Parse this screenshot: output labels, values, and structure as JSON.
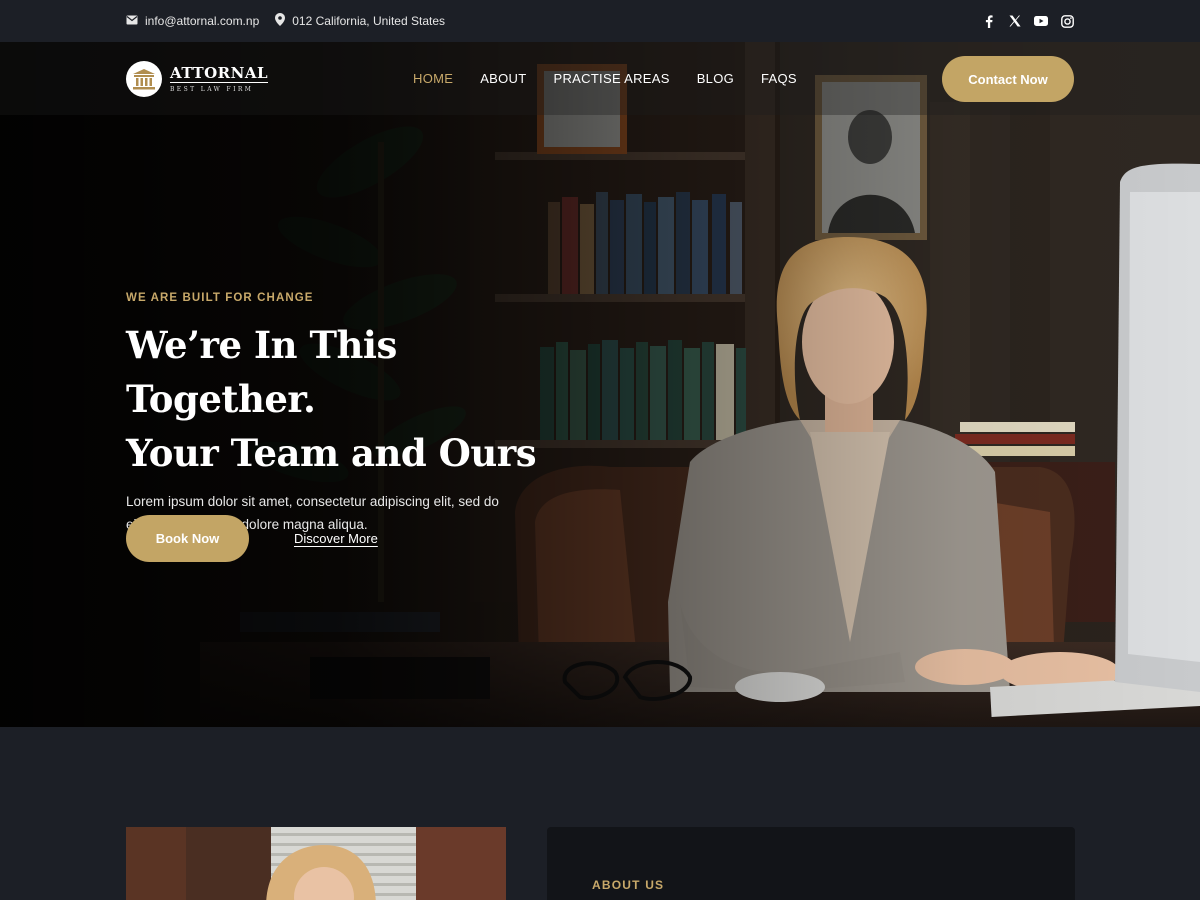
{
  "topbar": {
    "email": "info@attornal.com.np",
    "address": "012 California, United States",
    "social_icons": [
      "facebook-icon",
      "x-icon",
      "youtube-icon",
      "instagram-icon"
    ]
  },
  "brand": {
    "name": "ATTORNAL",
    "tagline": "BEST LAW FIRM"
  },
  "nav": {
    "items": [
      "HOME",
      "ABOUT",
      "PRACTISE AREAS",
      "BLOG",
      "FAQS"
    ],
    "active": "HOME",
    "contact_label": "Contact Now"
  },
  "hero": {
    "eyebrow": "WE ARE BUILT FOR CHANGE",
    "headline_line1": "We’re In This Together.",
    "headline_line2": "Your Team and Ours",
    "subtext": "Lorem ipsum dolor sit amet, consectetur adipiscing elit, sed do eiusmod tempor et dolore magna aliqua.",
    "book_label": "Book Now",
    "discover_label": "Discover More"
  },
  "about": {
    "label": "ABOUT US"
  },
  "colors": {
    "accent": "#c3a565",
    "accent_text": "#c8a96a",
    "background": "#1c1f26"
  }
}
